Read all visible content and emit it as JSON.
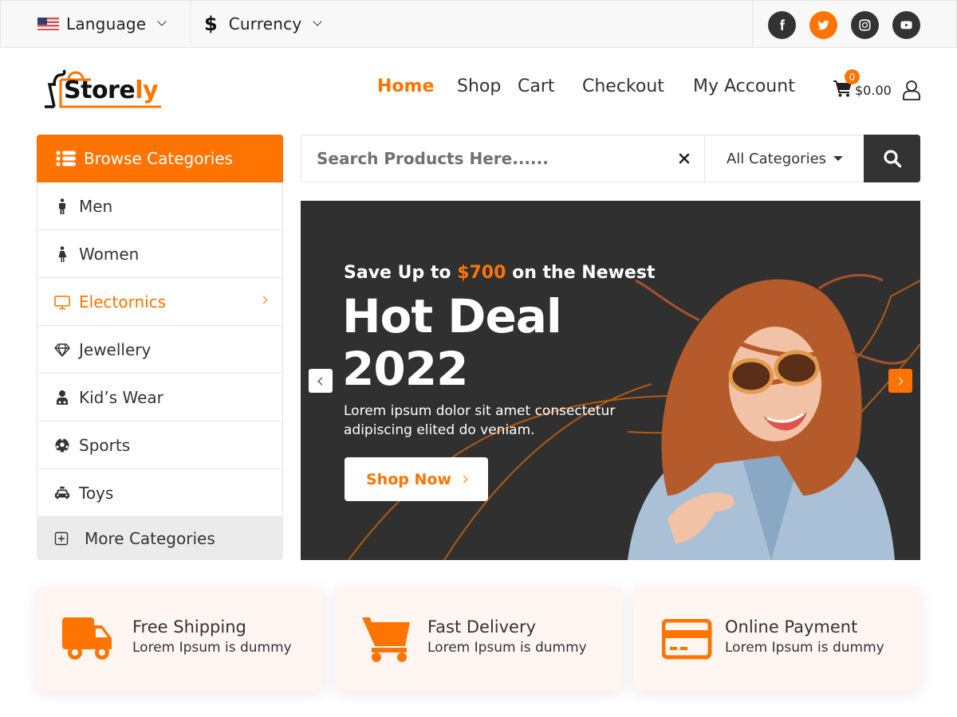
{
  "topbar": {
    "language": {
      "icon": "us-flag-icon",
      "label": "Language"
    },
    "currency": {
      "icon": "dollar-icon",
      "symbol": "$",
      "label": "Currency"
    },
    "social": [
      {
        "name": "facebook",
        "icon": "facebook-icon"
      },
      {
        "name": "twitter",
        "icon": "twitter-icon",
        "highlighted": true
      },
      {
        "name": "instagram",
        "icon": "instagram-icon"
      },
      {
        "name": "youtube",
        "icon": "youtube-icon"
      }
    ]
  },
  "header": {
    "logo": {
      "text_main": "Store",
      "text_accent": "ly"
    },
    "nav": [
      {
        "label": "Home",
        "active": true
      },
      {
        "label": "Shop"
      },
      {
        "label": "Cart"
      },
      {
        "label": "Checkout"
      },
      {
        "label": "My Account"
      }
    ],
    "cart": {
      "count": "0",
      "amount": "$0.00"
    },
    "user_icon": "user-icon"
  },
  "sidebar": {
    "title": "Browse Categories",
    "items": [
      {
        "label": "Men",
        "icon": "male-icon"
      },
      {
        "label": "Women",
        "icon": "female-icon"
      },
      {
        "label": "Electornics",
        "icon": "monitor-icon",
        "active": true,
        "has_submenu": true
      },
      {
        "label": "Jewellery",
        "icon": "diamond-icon"
      },
      {
        "label": "Kid’s Wear",
        "icon": "kid-icon"
      },
      {
        "label": "Sports",
        "icon": "football-icon"
      },
      {
        "label": "Toys",
        "icon": "taxi-icon"
      }
    ],
    "more": {
      "label": "More Categories",
      "icon": "plus-square-icon"
    }
  },
  "search": {
    "placeholder": "Search Products Here......",
    "value": "",
    "category_selected": "All Categories"
  },
  "hero": {
    "eyebrow_pre": "Save Up to ",
    "eyebrow_accent": "$700",
    "eyebrow_post": " on the Newest",
    "title_line1": "Hot Deal",
    "title_line2": "2022",
    "description": "Lorem ipsum dolor sit amet consectetur adipiscing elited do veniam.",
    "cta": "Shop Now"
  },
  "features": [
    {
      "title": "Free Shipping",
      "desc": "Lorem Ipsum is dummy",
      "icon": "truck-icon"
    },
    {
      "title": "Fast Delivery",
      "desc": "Lorem Ipsum is dummy",
      "icon": "shopping-cart-icon"
    },
    {
      "title": "Online Payment",
      "desc": "Lorem Ipsum is dummy",
      "icon": "credit-card-icon"
    }
  ],
  "colors": {
    "accent": "#ff7400",
    "dark": "#333333",
    "hero_bg": "#303030",
    "feature_bg": "#fff6f2"
  }
}
